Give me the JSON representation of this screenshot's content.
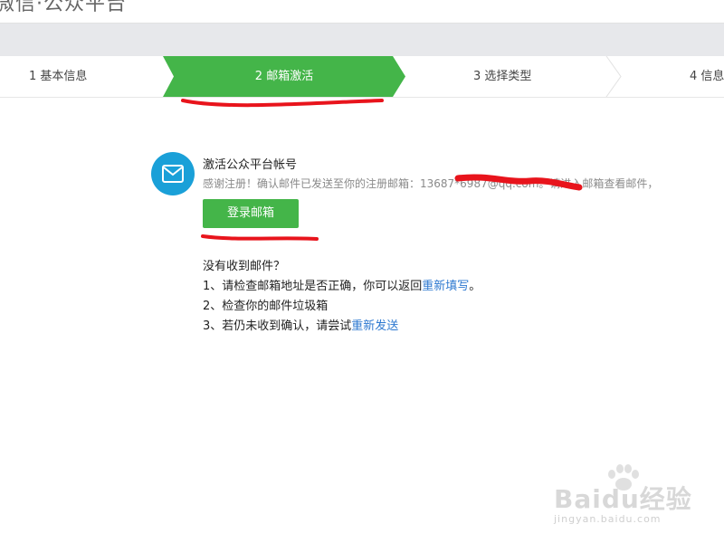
{
  "header": {
    "title": "微信·公众平台"
  },
  "steps": [
    {
      "label": "1 基本信息"
    },
    {
      "label": "2 邮箱激活"
    },
    {
      "label": "3 选择类型"
    },
    {
      "label": "4 信息"
    }
  ],
  "activation": {
    "heading": "激活公众平台帐号",
    "description": "感谢注册！确认邮件已发送至你的注册邮箱：13687*6987@qq.com。请进入邮箱查看邮件，",
    "login_button": "登录邮箱"
  },
  "help": {
    "title": "没有收到邮件？",
    "line1_text": "1、请检查邮箱地址是否正确，你可以返回",
    "line1_link": "重新填写",
    "line1_end": "。",
    "line2_text": "2、检查你的邮件垃圾箱",
    "line3_text": "3、若仍未收到确认，请尝试",
    "line3_link": "重新发送"
  },
  "watermark": {
    "logo": "Baidu经验",
    "url": "jingyan.baidu.com"
  },
  "colors": {
    "accent_green": "#44b549",
    "mail_blue": "#1aa0d8",
    "link_blue": "#2e79d0",
    "annotation_red": "#e8141c"
  },
  "icons": {
    "mail": "envelope-icon"
  }
}
